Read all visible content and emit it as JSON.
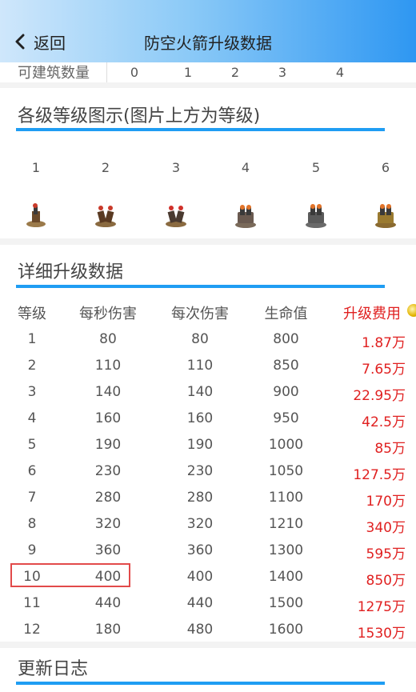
{
  "header": {
    "back_label": "返回",
    "title": "防空火箭升级数据"
  },
  "buildable": {
    "label": "可建筑数量",
    "values": [
      "0",
      "1",
      "2",
      "3",
      "4"
    ]
  },
  "levels_section": {
    "title": "各级等级图示(图片上方为等级)",
    "levels": [
      "1",
      "2",
      "3",
      "4",
      "5",
      "6"
    ]
  },
  "details_section": {
    "title": "详细升级数据",
    "headers": [
      "等级",
      "每秒伤害",
      "每次伤害",
      "生命值",
      "升级费用"
    ],
    "rows": [
      [
        "1",
        "80",
        "80",
        "800",
        "1.87万"
      ],
      [
        "2",
        "110",
        "110",
        "850",
        "7.65万"
      ],
      [
        "3",
        "140",
        "140",
        "900",
        "22.95万"
      ],
      [
        "4",
        "160",
        "160",
        "950",
        "42.5万"
      ],
      [
        "5",
        "190",
        "190",
        "1000",
        "85万"
      ],
      [
        "6",
        "230",
        "230",
        "1050",
        "127.5万"
      ],
      [
        "7",
        "280",
        "280",
        "1100",
        "170万"
      ],
      [
        "8",
        "320",
        "320",
        "1210",
        "340万"
      ],
      [
        "9",
        "360",
        "360",
        "1300",
        "595万"
      ],
      [
        "10",
        "400",
        "400",
        "1400",
        "850万"
      ],
      [
        "11",
        "440",
        "440",
        "1500",
        "1275万"
      ],
      [
        "12",
        "180",
        "480",
        "1600",
        "1530万"
      ]
    ]
  },
  "log_section": {
    "title": "更新日志"
  },
  "colors": {
    "accent": "#1f9df3",
    "cost": "#e02020",
    "highlight": "#e24a4a"
  }
}
